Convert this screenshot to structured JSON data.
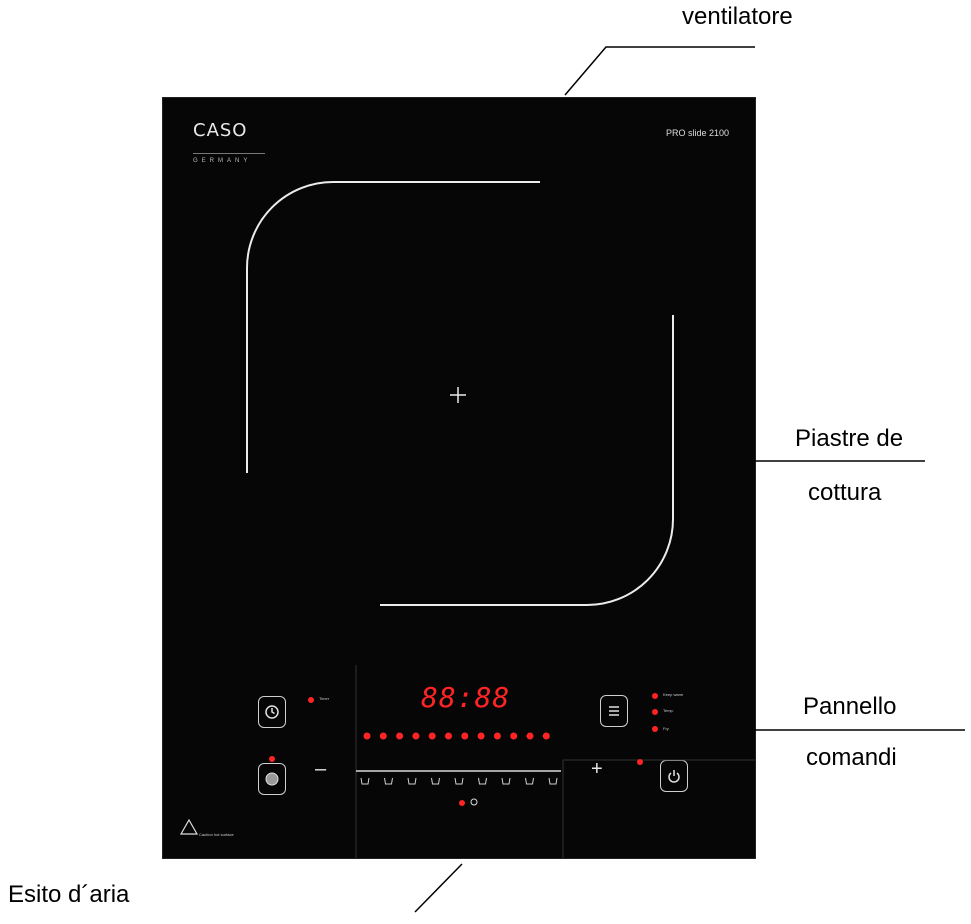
{
  "callouts": {
    "fan": "ventilatore",
    "plate_line1": "Piastre de",
    "plate_line2": "cottura",
    "panel_line1": "Pannello",
    "panel_line2": "comandi",
    "air_outlet": "Esito d´aria"
  },
  "cooktop": {
    "brand": "CASO",
    "brand_sub": "GERMANY",
    "model": "PRO slide 2100",
    "display": "88:88",
    "timer_label": "Timer",
    "modes": [
      "Keep warm",
      "Temp.",
      "Fry"
    ],
    "warning": "Caution hot surface",
    "minus": "–",
    "plus": "+",
    "center_mark": "+"
  },
  "colors": {
    "glass": "#060606",
    "led_red": "#ff2424",
    "line": "#ffffff"
  },
  "icons": {
    "timer": "clock-icon",
    "menu": "menu-icon",
    "boost": "disc-icon",
    "power": "power-icon",
    "warning": "hot-surface-warning-icon"
  }
}
